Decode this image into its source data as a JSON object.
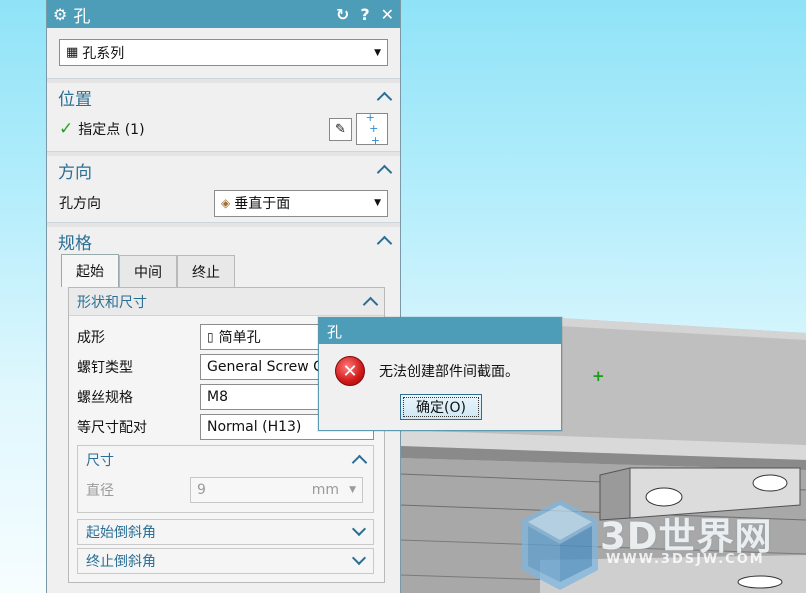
{
  "panel": {
    "title": "孔",
    "icons": {
      "settings": "gear-icon",
      "reset": "reset-icon",
      "help": "help-icon",
      "close": "close-icon"
    },
    "type_select": {
      "value": "孔系列"
    },
    "position": {
      "heading": "位置",
      "specify_point_label": "指定点 (1)"
    },
    "direction": {
      "heading": "方向",
      "hole_direction_label": "孔方向",
      "hole_direction_value": "垂直于面"
    },
    "specification": {
      "heading": "规格",
      "tabs": [
        "起始",
        "中间",
        "终止"
      ],
      "active_tab": "起始",
      "shape_size": {
        "heading": "形状和尺寸",
        "fields": [
          {
            "label": "成形",
            "value": "简单孔"
          },
          {
            "label": "螺钉类型",
            "value": "General Screw C"
          },
          {
            "label": "螺丝规格",
            "value": "M8"
          },
          {
            "label": "等尺寸配对",
            "value": "Normal (H13)"
          }
        ],
        "dimension": {
          "heading": "尺寸",
          "diameter_label": "直径",
          "diameter_value": "9",
          "diameter_unit": "mm"
        }
      },
      "start_chamfer": "起始倒斜角",
      "end_chamfer": "终止倒斜角"
    }
  },
  "dialog": {
    "title": "孔",
    "message": "无法创建部件间截面。",
    "ok_label": "确定(O)"
  },
  "watermark": {
    "text": "3D世界网",
    "url": "WWW.3DSJW.COM"
  },
  "colors": {
    "title_bar": "#4d9db8",
    "section_heading": "#2b6f95",
    "viewport_top": "#8fe3f7",
    "check": "#24a224",
    "error": "#d01818"
  }
}
